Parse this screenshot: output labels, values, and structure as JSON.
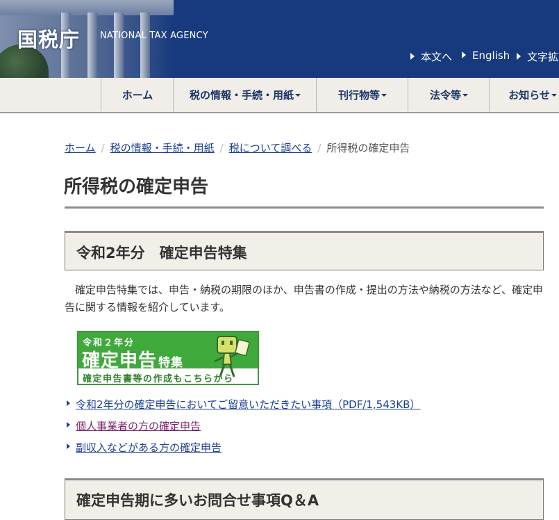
{
  "header": {
    "title": "国税庁",
    "subtitle": "NATIONAL TAX AGENCY",
    "utility_links": [
      {
        "label": "本文へ"
      },
      {
        "label": "English"
      },
      {
        "label": "文字拡大"
      }
    ]
  },
  "global_nav": [
    {
      "label": "ホーム",
      "has_dropdown": false
    },
    {
      "label": "税の情報・手続・用紙",
      "has_dropdown": true
    },
    {
      "label": "刊行物等",
      "has_dropdown": true
    },
    {
      "label": "法令等",
      "has_dropdown": true
    },
    {
      "label": "お知らせ",
      "has_dropdown": true
    }
  ],
  "breadcrumb": {
    "items": [
      "ホーム",
      "税の情報・手続・用紙",
      "税について調べる"
    ],
    "current": "所得税の確定申告"
  },
  "page": {
    "title": "所得税の確定申告"
  },
  "section1": {
    "heading": "令和2年分　確定申告特集",
    "intro": "確定申告特集では、申告・納税の期限のほか、申告書の作成・提出の方法や納税の方法など、確定申告に関する情報を紹介しています。",
    "banner": {
      "year": "令和２年分",
      "main": "確定申告",
      "main_suffix": "特集",
      "sub": "確定申告書等の作成もこちらから"
    },
    "links": [
      {
        "label": "令和2年分の確定申告においてご留意いただきたい事項（PDF/1,543KB）",
        "visited": false
      },
      {
        "label": "個人事業者の方の確定申告",
        "visited": true
      },
      {
        "label": "副収入などがある方の確定申告",
        "visited": false
      }
    ]
  },
  "section2": {
    "heading": "確定申告期に多いお問合せ事項Q＆A"
  },
  "colors": {
    "header_bg": "#173a7e",
    "nav_bg": "#f1eee9",
    "nav_text": "#1b3467",
    "link": "#1a3f93",
    "visited_link": "#7d1f6d",
    "banner_green": "#3fa93b"
  }
}
